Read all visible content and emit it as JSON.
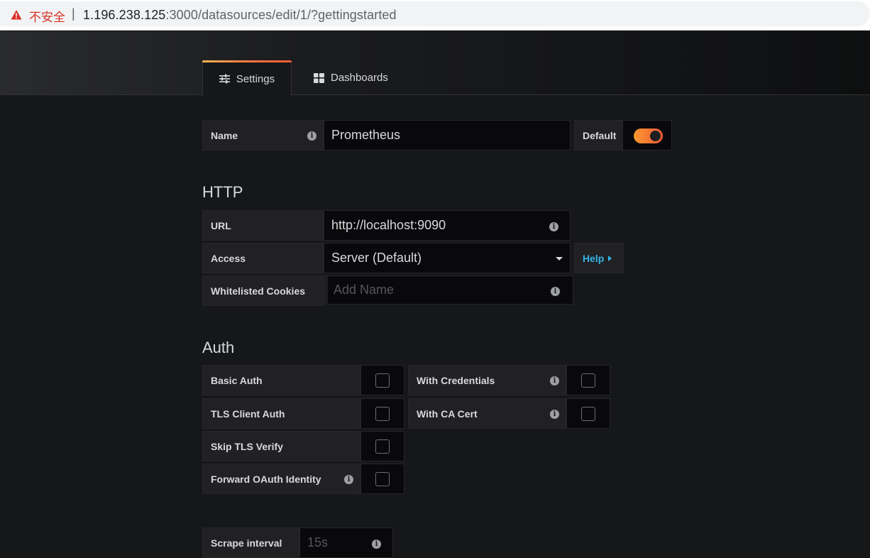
{
  "browser": {
    "security_label": "不安全",
    "separator": "|",
    "url_host": "1.196.238.125",
    "url_rest": ":3000/datasources/edit/1/?gettingstarted"
  },
  "tabs": [
    {
      "label": "Settings",
      "icon": "sliders-icon",
      "active": true
    },
    {
      "label": "Dashboards",
      "icon": "grid-icon",
      "active": false
    }
  ],
  "name_row": {
    "label": "Name",
    "value": "Prometheus",
    "default_label": "Default",
    "default_on": true
  },
  "http": {
    "title": "HTTP",
    "url_label": "URL",
    "url_value": "http://localhost:9090",
    "access_label": "Access",
    "access_value": "Server (Default)",
    "help_label": "Help",
    "cookies_label": "Whitelisted Cookies",
    "cookies_placeholder": "Add Name"
  },
  "auth": {
    "title": "Auth",
    "left": [
      {
        "label": "Basic Auth",
        "checked": false
      },
      {
        "label": "TLS Client Auth",
        "checked": false
      },
      {
        "label": "Skip TLS Verify",
        "checked": false
      },
      {
        "label": "Forward OAuth Identity",
        "checked": false
      }
    ],
    "right": [
      {
        "label": "With Credentials",
        "checked": false
      },
      {
        "label": "With CA Cert",
        "checked": false
      }
    ]
  },
  "scrape": {
    "label": "Scrape interval",
    "placeholder": "15s"
  },
  "colors": {
    "accent_orange": "#eb5a36",
    "link_blue": "#33b5e5",
    "background": "#161719"
  }
}
